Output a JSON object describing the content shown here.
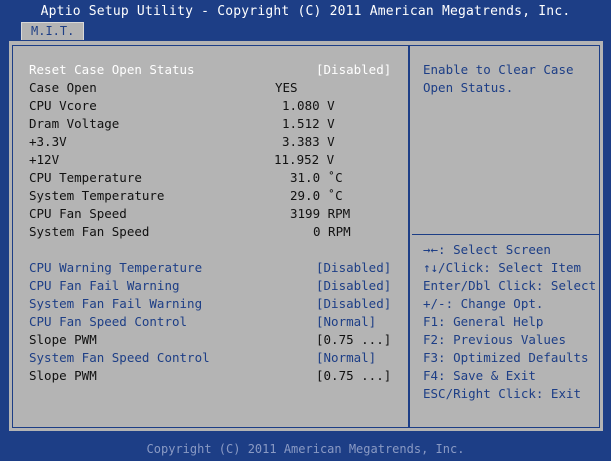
{
  "header": {
    "title": "Aptio Setup Utility - Copyright (C) 2011 American Megatrends, Inc.",
    "tab": "M.I.T."
  },
  "items": [
    {
      "label": "Reset Case Open Status",
      "value": "[Disabled]",
      "style": "white"
    },
    {
      "label": "Case Open",
      "value": "YES",
      "style": "black"
    },
    {
      "label": "CPU Vcore",
      "value": "1.080 V",
      "style": "black"
    },
    {
      "label": "Dram Voltage",
      "value": "1.512 V",
      "style": "black"
    },
    {
      "label": "+3.3V",
      "value": "3.383 V",
      "style": "black"
    },
    {
      "label": "+12V",
      "value": "11.952 V",
      "style": "black"
    },
    {
      "label": "CPU Temperature",
      "value": "31.0 ˚C",
      "style": "black"
    },
    {
      "label": "System Temperature",
      "value": "29.0 ˚C",
      "style": "black"
    },
    {
      "label": "CPU Fan Speed",
      "value": "3199 RPM",
      "style": "black"
    },
    {
      "label": "System Fan Speed",
      "value": "0 RPM",
      "style": "black"
    },
    {
      "label": "CPU Warning Temperature",
      "value": "[Disabled]",
      "style": "blue"
    },
    {
      "label": "CPU Fan Fail Warning",
      "value": "[Disabled]",
      "style": "blue"
    },
    {
      "label": "System Fan Fail Warning",
      "value": "[Disabled]",
      "style": "blue"
    },
    {
      "label": "CPU Fan Speed Control",
      "value": "[Normal]",
      "style": "blue"
    },
    {
      "label": "Slope PWM",
      "value": "[0.75 ...]",
      "style": "black"
    },
    {
      "label": "System Fan Speed Control",
      "value": "[Normal]",
      "style": "blue"
    },
    {
      "label": "Slope PWM",
      "value": "[0.75 ...]",
      "style": "black"
    }
  ],
  "help": {
    "description": [
      "Enable to Clear Case",
      "Open Status."
    ],
    "keys": [
      "→←: Select Screen",
      "↑↓/Click: Select Item",
      "Enter/Dbl Click: Select",
      "+/-: Change Opt.",
      "F1: General Help",
      "F2: Previous Values",
      "F3: Optimized Defaults",
      "F4: Save & Exit",
      "ESC/Right Click: Exit"
    ]
  },
  "footer": {
    "text": "Copyright (C) 2011 American Megatrends, Inc."
  },
  "colors": {
    "background": "#1d3e86",
    "panel": "#b4b4b4",
    "selected_text": "#ffffff",
    "disabled_text": "#1d3e86"
  }
}
